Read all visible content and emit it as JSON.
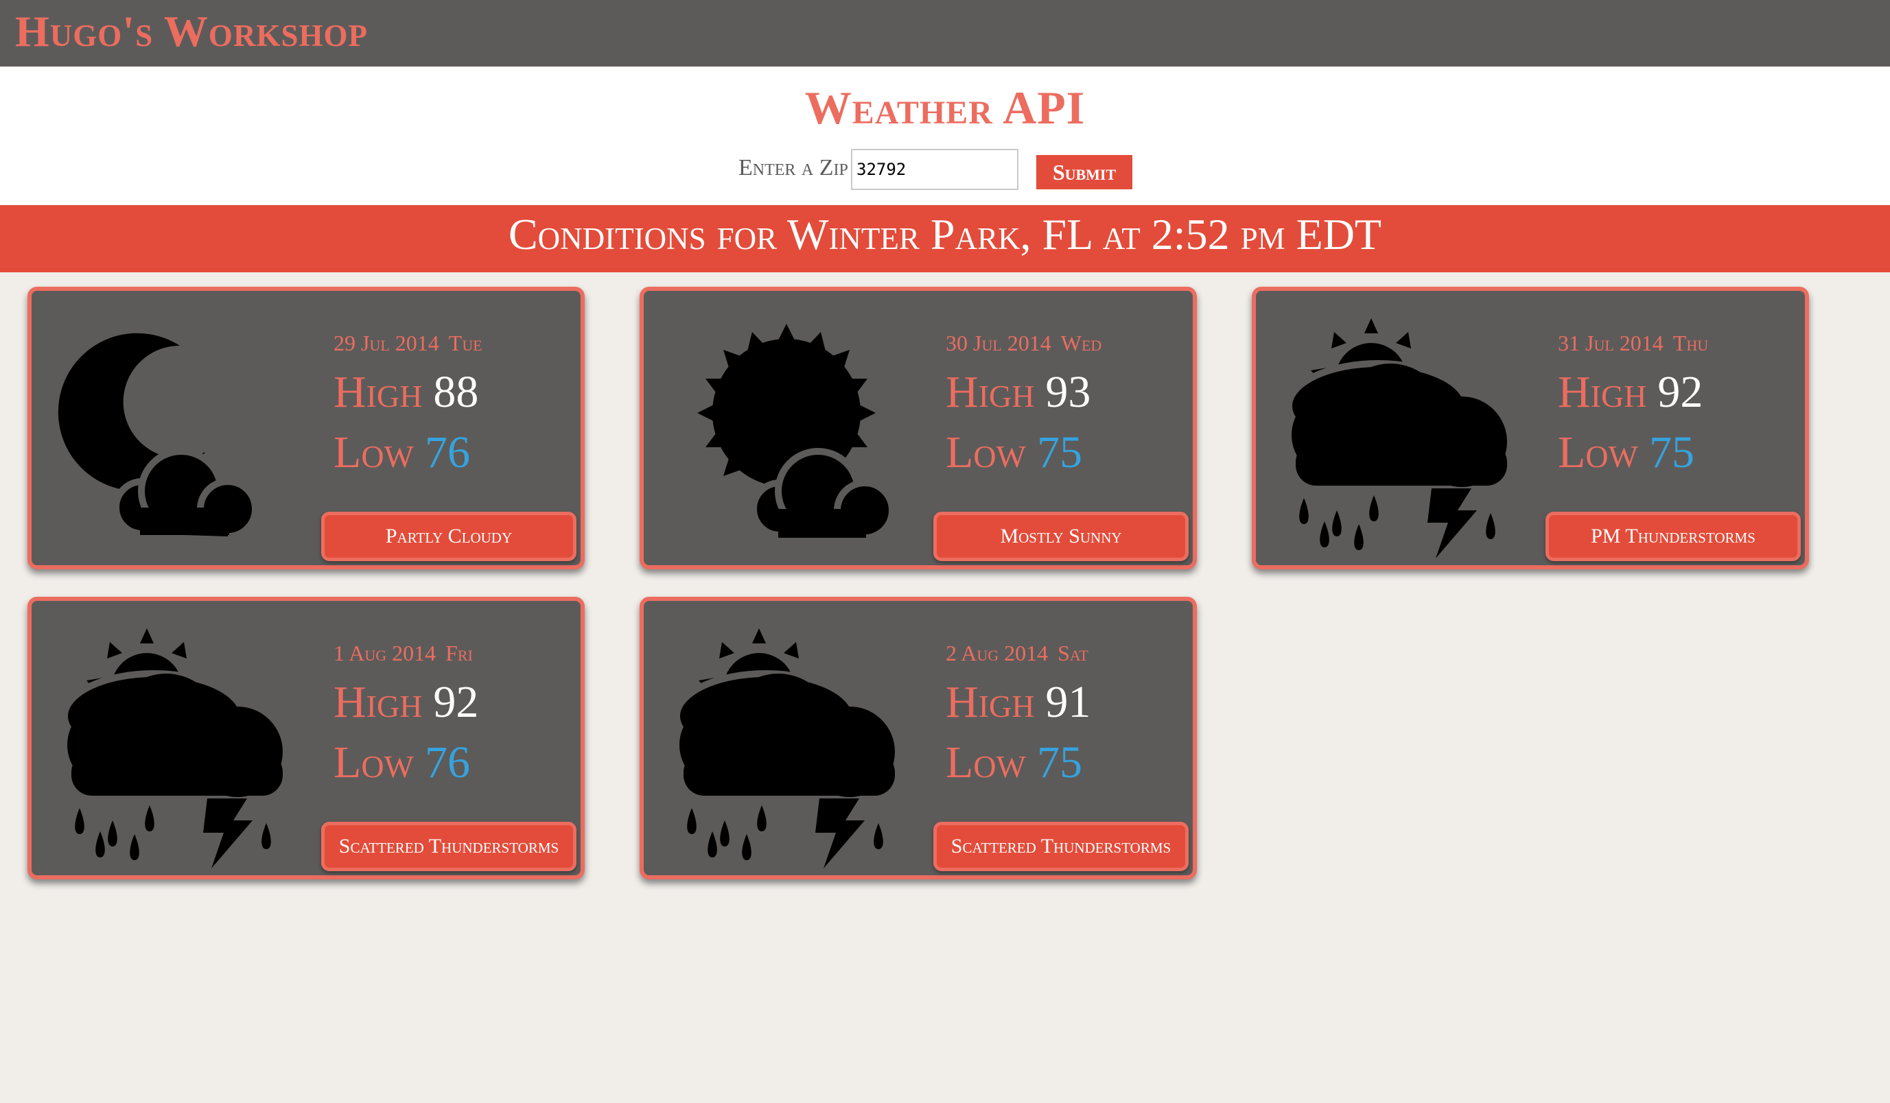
{
  "header": {
    "brand": "Hugo's Workshop"
  },
  "page": {
    "title": "Weather API"
  },
  "zip_form": {
    "label": "Enter a Zip",
    "value": "32792",
    "submit_label": "Submit"
  },
  "banner": {
    "text": "Conditions for Winter Park, FL at 2:52 pm EDT"
  },
  "colors": {
    "accent": "#e34c3a",
    "accent_light": "#ec6d5f",
    "card_bg": "#5c5b5a",
    "low_temp": "#36a3de",
    "topbar": "#5d5b5a",
    "page_bg": "#f1eeea"
  },
  "forecast": [
    {
      "date": "29 Jul 2014",
      "day": "Tue",
      "high_label": "High",
      "high": "88",
      "low_label": "Low",
      "low": "76",
      "condition": "Partly Cloudy",
      "icon": "moon-cloud-icon"
    },
    {
      "date": "30 Jul 2014",
      "day": "Wed",
      "high_label": "High",
      "high": "93",
      "low_label": "Low",
      "low": "75",
      "condition": "Mostly Sunny",
      "icon": "sun-cloud-icon"
    },
    {
      "date": "31 Jul 2014",
      "day": "Thu",
      "high_label": "High",
      "high": "92",
      "low_label": "Low",
      "low": "75",
      "condition": "PM Thunderstorms",
      "icon": "thunderstorm-icon"
    },
    {
      "date": "1 Aug 2014",
      "day": "Fri",
      "high_label": "High",
      "high": "92",
      "low_label": "Low",
      "low": "76",
      "condition": "Scattered Thunderstorms",
      "icon": "thunderstorm-icon"
    },
    {
      "date": "2 Aug 2014",
      "day": "Sat",
      "high_label": "High",
      "high": "91",
      "low_label": "Low",
      "low": "75",
      "condition": "Scattered Thunderstorms",
      "icon": "thunderstorm-icon"
    }
  ]
}
